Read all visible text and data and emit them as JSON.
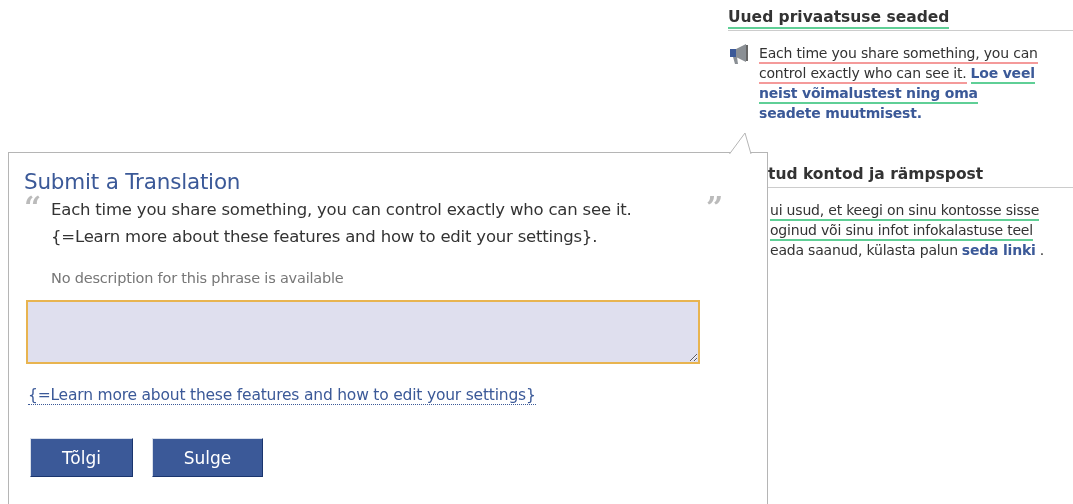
{
  "sidebar": {
    "sections": [
      {
        "heading": "Uued privaatsuse seaded",
        "heading_underlined": true,
        "icon": true,
        "lines": [
          {
            "segments": [
              {
                "text": "Each time you share something, you can",
                "kind": "text",
                "underlined": true,
                "translated": false
              }
            ]
          },
          {
            "segments": [
              {
                "text": "control exactly who can see it.",
                "kind": "text",
                "underlined": true,
                "translated": false
              },
              {
                "text": "Loe veel",
                "kind": "link",
                "underlined": true,
                "translated": true
              }
            ]
          },
          {
            "segments": [
              {
                "text": "neist võimalustest ning oma",
                "kind": "link",
                "underlined": true,
                "translated": true
              }
            ]
          },
          {
            "segments": [
              {
                "text": "seadete muutmisest.",
                "kind": "link",
                "underlined": false
              }
            ]
          }
        ]
      },
      {
        "heading": "tud kontod ja rämpspost",
        "heading_underlined": false,
        "icon": false,
        "lines": [
          {
            "segments": [
              {
                "text": "ui usud, et keegi on sinu kontosse sisse",
                "kind": "text",
                "underlined": true,
                "translated": true
              }
            ]
          },
          {
            "segments": [
              {
                "text": "oginud või sinu infot infokalastuse teel",
                "kind": "text",
                "underlined": true,
                "translated": true
              }
            ]
          },
          {
            "segments": [
              {
                "text": "eada saanud, külasta palun",
                "kind": "text",
                "underlined": false
              },
              {
                "text": "seda linki",
                "kind": "link",
                "underlined": false
              },
              {
                "text": ".",
                "kind": "text",
                "underlined": false
              }
            ]
          }
        ]
      }
    ]
  },
  "dialog": {
    "title": "Submit a Translation",
    "open_quote": "“",
    "close_quote": "”",
    "phrase": [
      "Each time you share something, you can control exactly who can see it.",
      "{=Learn more about these features and how to edit your settings}."
    ],
    "description": "No description for this phrase is available",
    "link": "{=Learn more about these features and how to edit your settings}",
    "buttons": [
      "Tõlgi",
      "Sulge"
    ]
  }
}
